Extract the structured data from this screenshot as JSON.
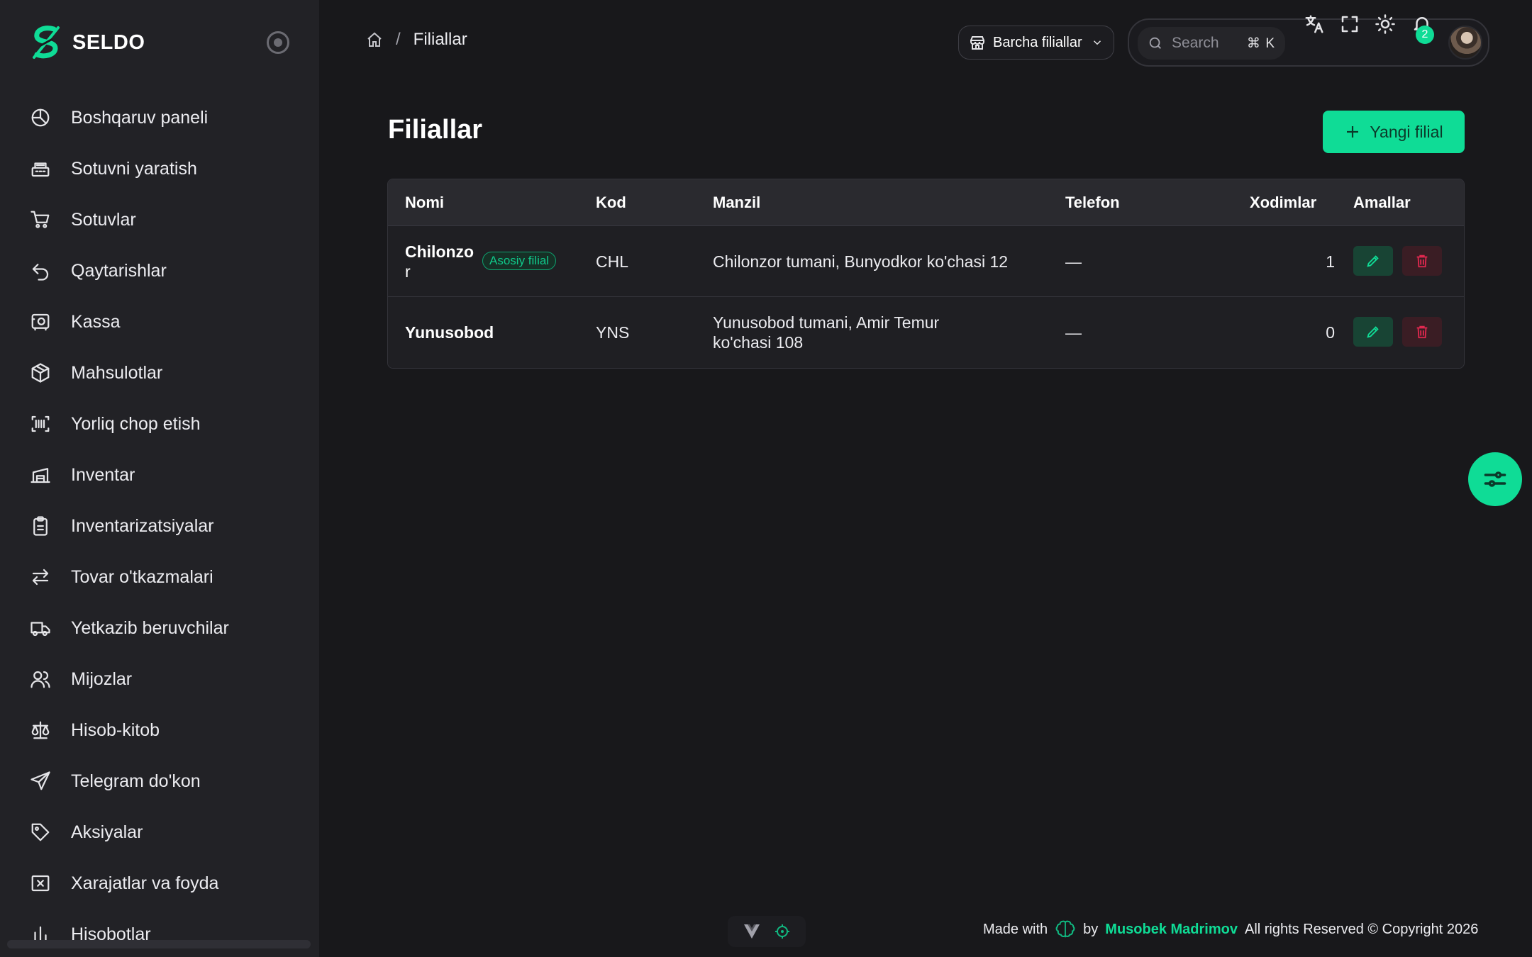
{
  "brand": {
    "name": "SELDO"
  },
  "sidebar": {
    "items": [
      {
        "label": "Boshqaruv paneli",
        "icon": "dashboard-icon"
      },
      {
        "label": "Sotuvni yaratish",
        "icon": "cash-register-icon"
      },
      {
        "label": "Sotuvlar",
        "icon": "cart-icon"
      },
      {
        "label": "Qaytarishlar",
        "icon": "return-icon"
      },
      {
        "label": "Kassa",
        "icon": "safe-icon"
      },
      {
        "label": "Mahsulotlar",
        "icon": "box-icon"
      },
      {
        "label": "Yorliq chop etish",
        "icon": "barcode-icon"
      },
      {
        "label": "Inventar",
        "icon": "warehouse-icon"
      },
      {
        "label": "Inventarizatsiyalar",
        "icon": "clipboard-icon"
      },
      {
        "label": "Tovar o'tkazmalari",
        "icon": "transfer-icon"
      },
      {
        "label": "Yetkazib beruvchilar",
        "icon": "truck-icon"
      },
      {
        "label": "Mijozlar",
        "icon": "users-icon"
      },
      {
        "label": "Hisob-kitob",
        "icon": "scale-icon"
      },
      {
        "label": "Telegram do'kon",
        "icon": "send-icon"
      },
      {
        "label": "Aksiyalar",
        "icon": "tag-icon"
      },
      {
        "label": "Xarajatlar va foyda",
        "icon": "receipt-x-icon"
      },
      {
        "label": "Hisobotlar",
        "icon": "report-icon"
      }
    ]
  },
  "header": {
    "breadcrumb_current": "Filiallar",
    "breadcrumb_separator": "/",
    "branch_select": "Barcha filiallar",
    "search_placeholder": "Search",
    "search_shortcut": "⌘ K",
    "notification_count": "2"
  },
  "main": {
    "title": "Filiallar",
    "new_button": "Yangi filial",
    "table": {
      "columns": [
        "Nomi",
        "Kod",
        "Manzil",
        "Telefon",
        "Xodimlar",
        "Amallar"
      ],
      "rows": [
        {
          "name_line1": "Chilonzo",
          "name_line2": "r",
          "tag": "Asosiy filial",
          "code": "CHL",
          "address_line1": "Chilonzor tumani, Bunyodkor ko'chasi 12",
          "address_line2": "",
          "phone": "—",
          "staff": "1"
        },
        {
          "name_line1": "Yunusobod",
          "name_line2": "",
          "tag": "",
          "code": "YNS",
          "address_line1": "Yunusobod tumani, Amir Temur",
          "address_line2": "ko'chasi 108",
          "phone": "—",
          "staff": "0"
        }
      ]
    }
  },
  "footer": {
    "made_with": "Made with",
    "by": "by",
    "author": "Musobek Madrimov",
    "rights": "All rights Reserved © Copyright 2026"
  },
  "colors": {
    "accent": "#0fdc96",
    "danger": "#e0284f",
    "background": "#18181b",
    "sidebar": "#222226"
  }
}
